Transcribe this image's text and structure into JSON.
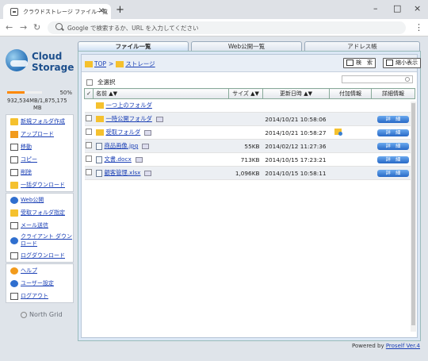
{
  "browser": {
    "tab_title": "クラウドストレージ ファイル一覧",
    "omnibox_placeholder": "Google で検索するか、URL を入力してください"
  },
  "logo": {
    "line1": "Cloud",
    "line2": "Storage"
  },
  "usage": {
    "percent_label": "50%",
    "amount_line1": "932,534MB/1,875,175",
    "amount_line2": "MB",
    "fill_fraction": 0.5,
    "color": "#ff8800"
  },
  "sidebar": {
    "group1": [
      {
        "label": "新規フォルダ作成",
        "icon": "folder-icon"
      },
      {
        "label": "アップロード",
        "icon": "upload-icon"
      },
      {
        "label": "移動",
        "icon": "move-icon"
      },
      {
        "label": "コピー",
        "icon": "copy-icon"
      },
      {
        "label": "削除",
        "icon": "delete-icon"
      },
      {
        "label": "一括ダウンロード",
        "icon": "download-icon"
      }
    ],
    "group2": [
      {
        "label": "Web公開",
        "icon": "web-publish-icon"
      },
      {
        "label": "受取フォルダ指定",
        "icon": "inbox-folder-icon"
      },
      {
        "label": "メール送信",
        "icon": "mail-icon"
      },
      {
        "label": "クライアント ダウンロード",
        "icon": "client-download-icon"
      },
      {
        "label": "ログダウンロード",
        "icon": "log-download-icon"
      }
    ],
    "group3": [
      {
        "label": "ヘルプ",
        "icon": "help-icon"
      },
      {
        "label": "ユーザー設定",
        "icon": "user-settings-icon"
      },
      {
        "label": "ログアウト",
        "icon": "logout-icon"
      }
    ],
    "brand": "North Grid"
  },
  "tabs": [
    "ファイル一覧",
    "Web公開一覧",
    "アドレス帳"
  ],
  "breadcrumb": {
    "root": "TOP",
    "separator": ">",
    "current": "ストレージ"
  },
  "buttons": {
    "search": "検　索",
    "shrink": "縮小表示"
  },
  "select_all_label": "全選択",
  "columns": {
    "name": "名前 ▲▼",
    "size": "サイズ ▲▼",
    "date": "更新日時 ▲▼",
    "extra": "付加情報",
    "detail": "詳細情報"
  },
  "rows": [
    {
      "type": "folder",
      "name": "一つ上のフォルダ",
      "size": "",
      "date": "",
      "checkbox": false,
      "preview": false,
      "flag": false,
      "detail": ""
    },
    {
      "type": "folder",
      "name": "一時公開フォルダ",
      "size": "",
      "date": "2014/10/21 10:58:06",
      "checkbox": true,
      "preview": true,
      "flag": false,
      "detail": "詳　細"
    },
    {
      "type": "folder",
      "name": "受取フォルダ",
      "size": "",
      "date": "2014/10/21 10:58:27",
      "checkbox": true,
      "preview": true,
      "flag": true,
      "detail": "詳　細"
    },
    {
      "type": "file",
      "name": "商品画像.jpg",
      "size": "55KB",
      "date": "2014/02/12 11:27:36",
      "checkbox": true,
      "preview": true,
      "flag": false,
      "detail": "詳　細"
    },
    {
      "type": "file",
      "name": "文書.docx",
      "size": "713KB",
      "date": "2014/10/15 17:23:21",
      "checkbox": true,
      "preview": true,
      "flag": false,
      "detail": "詳　細"
    },
    {
      "type": "file",
      "name": "顧客管理.xlsx",
      "size": "1,096KB",
      "date": "2014/10/15 10:58:11",
      "checkbox": true,
      "preview": true,
      "flag": false,
      "detail": "詳　細"
    }
  ],
  "footer": {
    "prefix": "Powered by ",
    "link": "Proself Ver.4"
  }
}
